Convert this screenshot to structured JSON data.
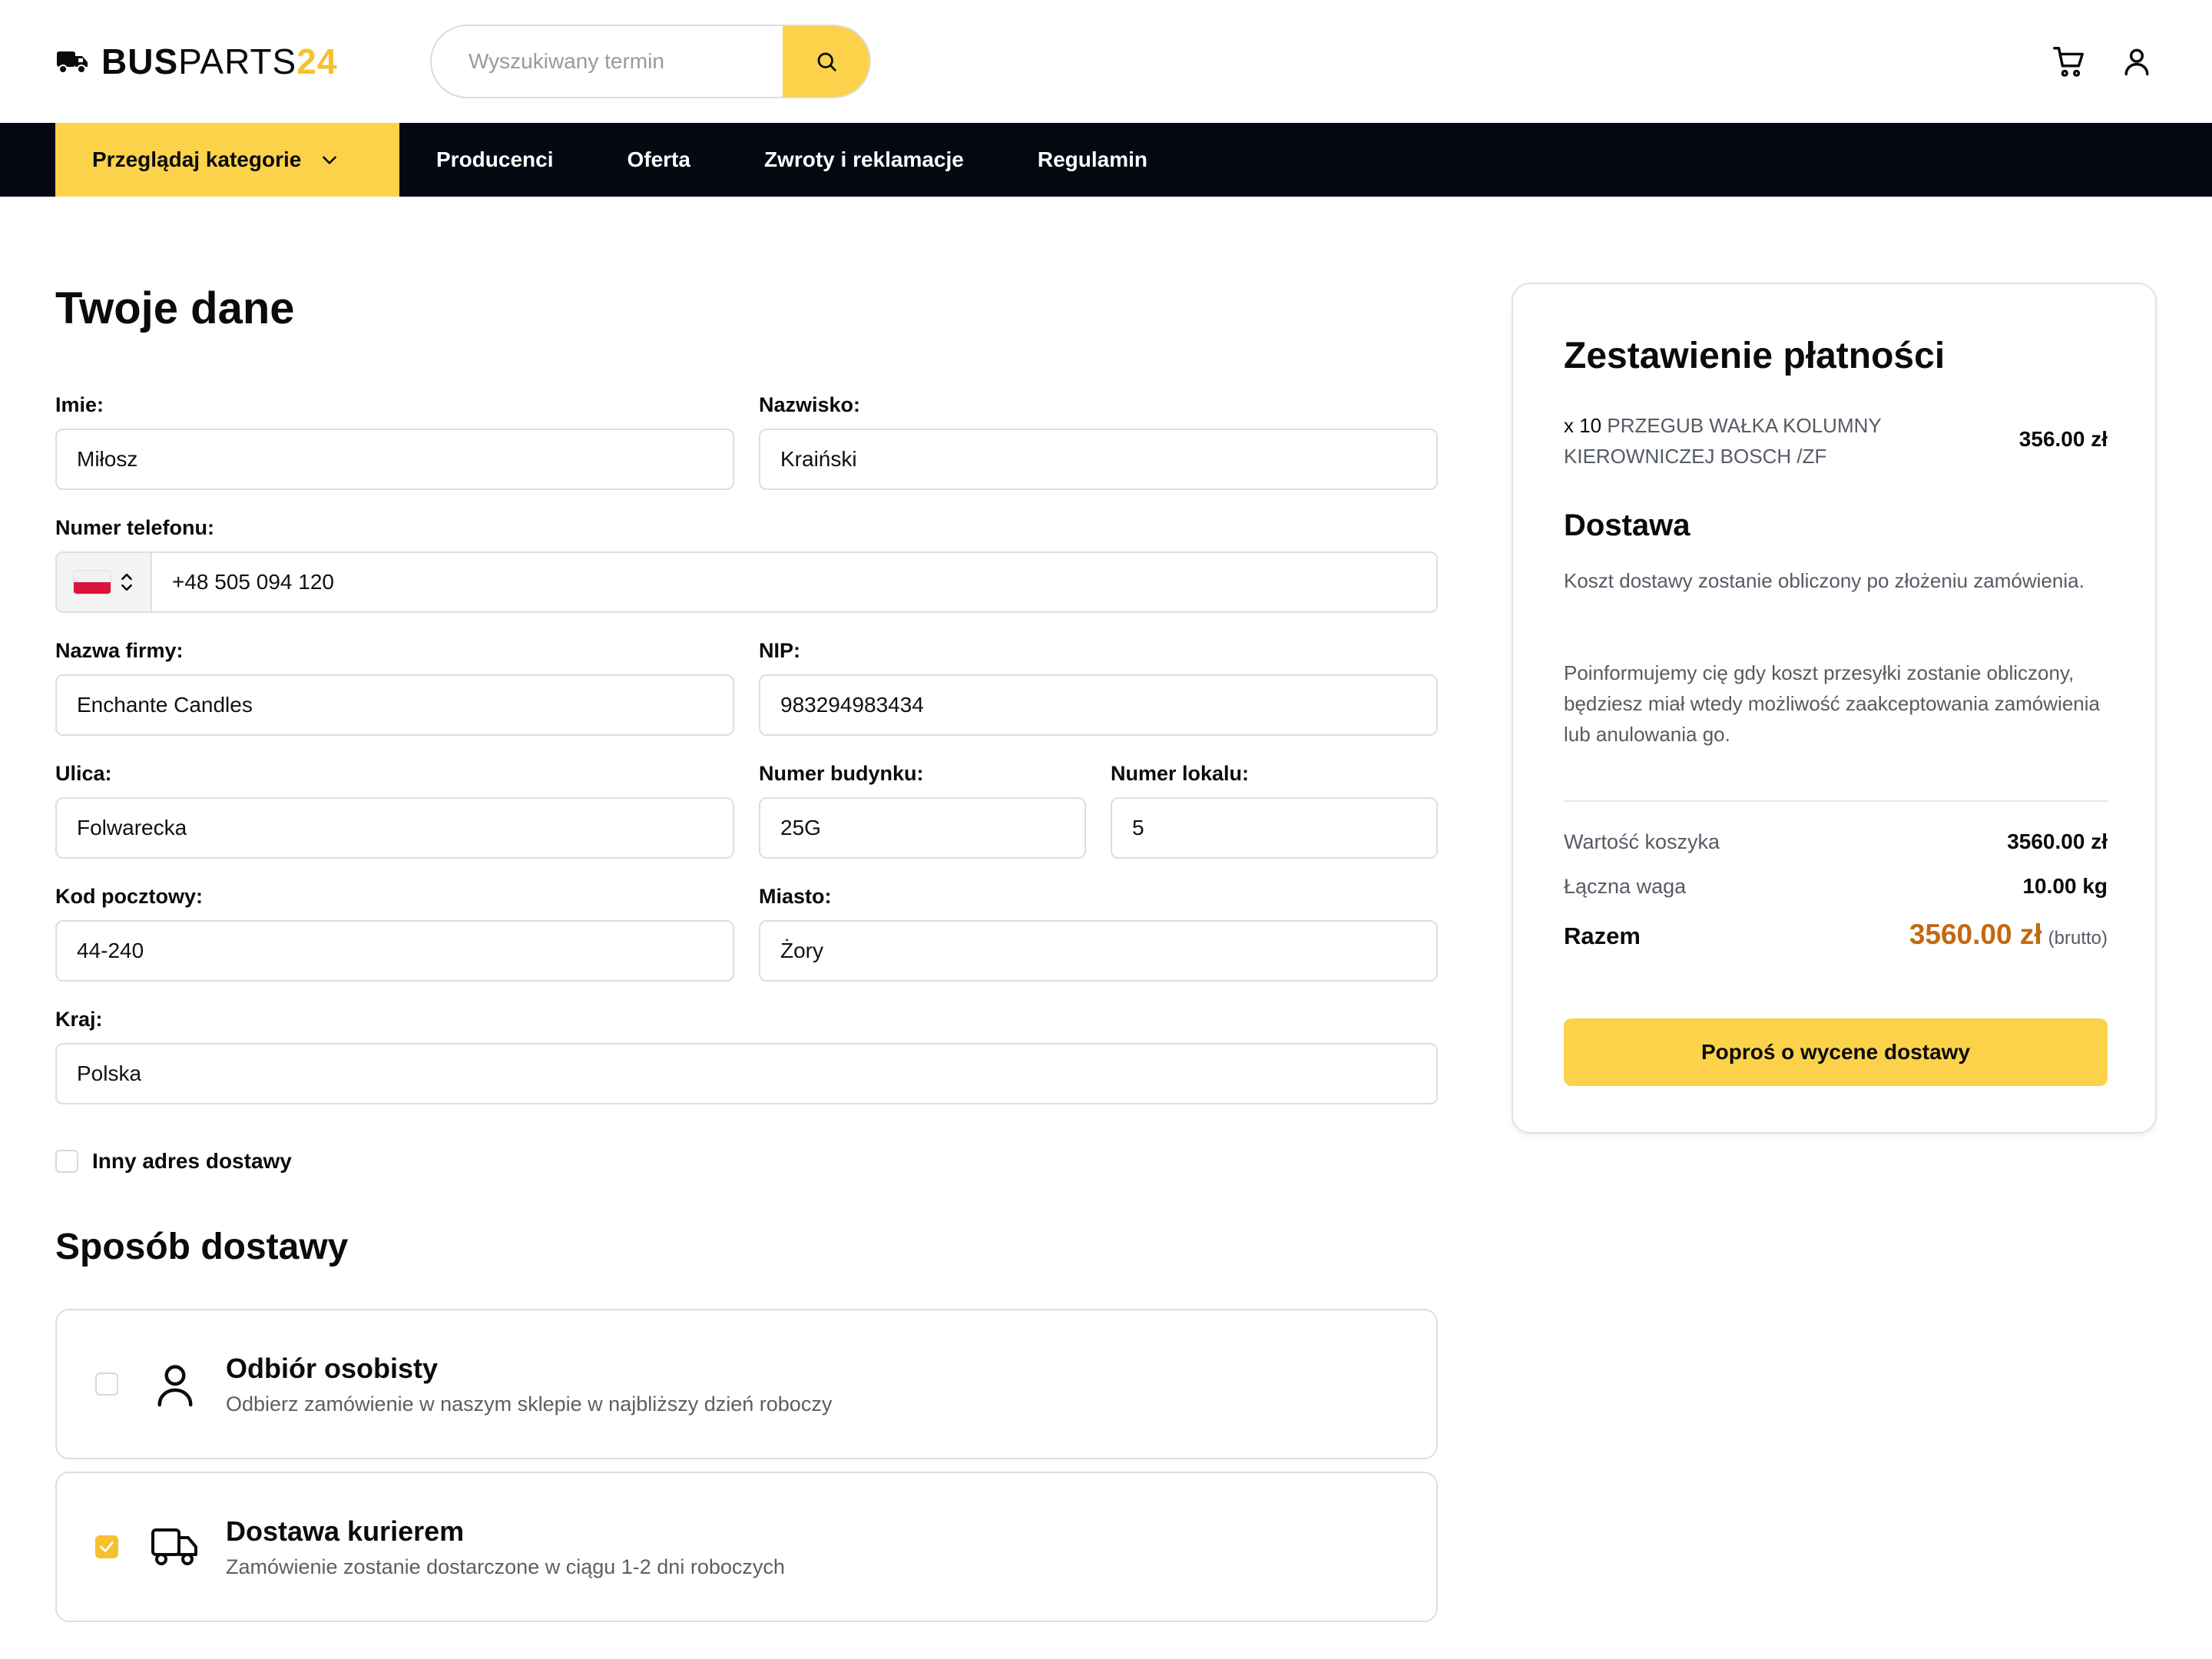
{
  "brand": {
    "part1": "BUS",
    "part2": "PARTS",
    "part3": "24"
  },
  "colors": {
    "accent": "#fbd24a",
    "nav_bg": "#030811",
    "total_price": "#c46910"
  },
  "search": {
    "placeholder": "Wyszukiwany termin"
  },
  "nav": {
    "categories_label": "Przeglądaj kategorie",
    "items": [
      "Producenci",
      "Oferta",
      "Zwroty i reklamacje",
      "Regulamin"
    ]
  },
  "form": {
    "title": "Twoje dane",
    "first_name": {
      "label": "Imie:",
      "value": "Miłosz"
    },
    "last_name": {
      "label": "Nazwisko:",
      "value": "Kraiński"
    },
    "phone": {
      "label": "Numer telefonu:",
      "value": "+48 505 094 120"
    },
    "company": {
      "label": "Nazwa firmy:",
      "value": "Enchante Candles"
    },
    "nip": {
      "label": "NIP:",
      "value": "983294983434"
    },
    "street": {
      "label": "Ulica:",
      "value": "Folwarecka"
    },
    "building": {
      "label": "Numer budynku:",
      "value": "25G"
    },
    "unit": {
      "label": "Numer lokalu:",
      "value": "5"
    },
    "postal": {
      "label": "Kod pocztowy:",
      "value": "44-240"
    },
    "city": {
      "label": "Miasto:",
      "value": "Żory"
    },
    "country": {
      "label": "Kraj:",
      "value": "Polska"
    },
    "alt_address_label": "Inny adres dostawy"
  },
  "shipping": {
    "title": "Sposób dostawy",
    "options": [
      {
        "title": "Odbiór osobisty",
        "desc": "Odbierz zamówienie w naszym sklepie w najbliższy dzień roboczy",
        "checked": false,
        "icon": "user-icon"
      },
      {
        "title": "Dostawa kurierem",
        "desc": "Zamówienie zostanie dostarczone w ciągu 1-2 dni roboczych",
        "checked": true,
        "icon": "truck-icon"
      }
    ]
  },
  "summary": {
    "title": "Zestawienie płatności",
    "item": {
      "qty": "x 10",
      "name": "PRZEGUB WAŁKA KOLUMNY KIEROWNICZEJ BOSCH /ZF",
      "price": "356.00 zł"
    },
    "delivery_title": "Dostawa",
    "delivery_p1": "Koszt dostawy zostanie obliczony po złożeniu zamówienia.",
    "delivery_p2": "Poinformujemy cię gdy koszt przesyłki zostanie obliczony, będziesz miał wtedy możliwość zaakceptowania zamówienia lub anulowania go.",
    "cart_value_label": "Wartość koszyka",
    "cart_value": "3560.00 zł",
    "weight_label": "Łączna waga",
    "weight": "10.00 kg",
    "total_label": "Razem",
    "total": "3560.00 zł",
    "total_note": "(brutto)",
    "button": "Poproś o wycene dostawy"
  }
}
